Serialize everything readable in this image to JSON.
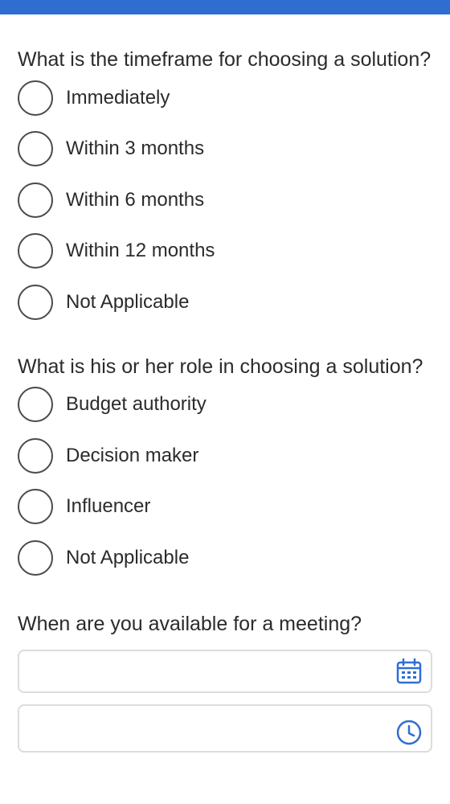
{
  "questions": [
    {
      "text": "What is the timeframe for choosing a solution?",
      "options": [
        "Immediately",
        "Within 3 months",
        "Within 6 months",
        "Within 12 months",
        "Not Applicable"
      ]
    },
    {
      "text": "What is his or her role in choosing a solution?",
      "options": [
        "Budget authority",
        "Decision maker",
        "Influencer",
        "Not Applicable"
      ]
    }
  ],
  "meeting": {
    "text": "When are you available for a meeting?",
    "date_value": "",
    "time_value": "",
    "date_icon": "calendar-icon",
    "time_icon": "clock-icon"
  },
  "colors": {
    "accent": "#2f6ed1",
    "text": "#2b2b2b",
    "border": "#dcdcdc"
  }
}
